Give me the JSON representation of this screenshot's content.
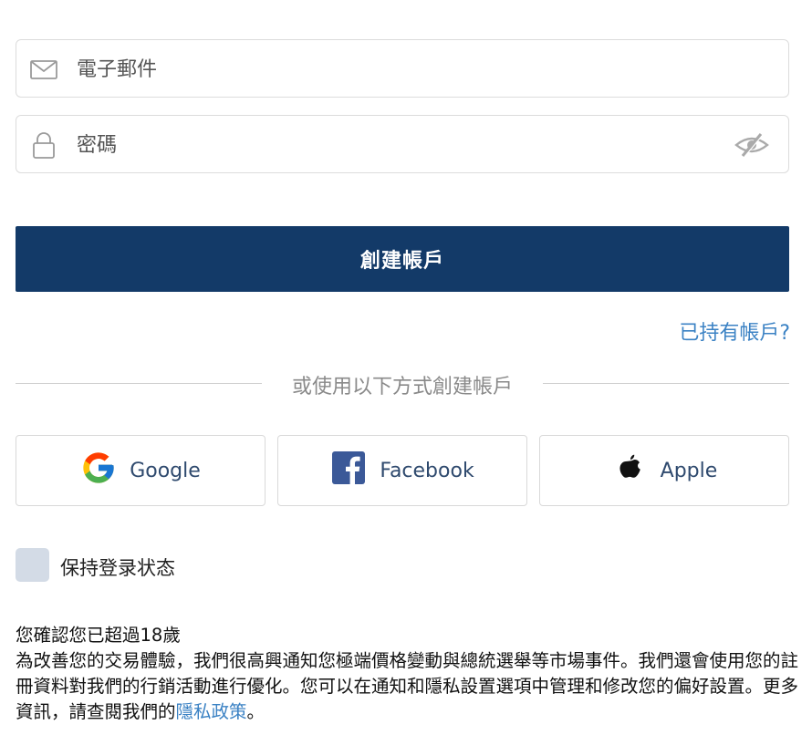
{
  "form": {
    "email_placeholder": "電子郵件",
    "password_placeholder": "密碼",
    "submit_label": "創建帳戶",
    "existing_account_link": "已持有帳戶?",
    "divider_text": "或使用以下方式創建帳戶",
    "remember_me_label": "保持登录状态",
    "remember_me_checked": false
  },
  "social": [
    {
      "label": "Google",
      "icon": "google-icon"
    },
    {
      "label": "Facebook",
      "icon": "facebook-icon"
    },
    {
      "label": "Apple",
      "icon": "apple-icon"
    }
  ],
  "legal": {
    "age_confirm": "您確認您已超過18歲",
    "consent_text": "為改善您的交易體驗，我們很高興通知您極端價格變動與總統選舉等市場事件。我們還會使用您的註冊資料對我們的行銷活動進行優化。您可以在通知和隱私設置選項中管理和修改您的偏好設置。更多資訊，請查閱我們的",
    "privacy_link": "隱私政策",
    "period": "。"
  },
  "colors": {
    "primary": "#133a68",
    "link": "#3b82c4",
    "checkbox_bg": "#d3dbe6"
  }
}
